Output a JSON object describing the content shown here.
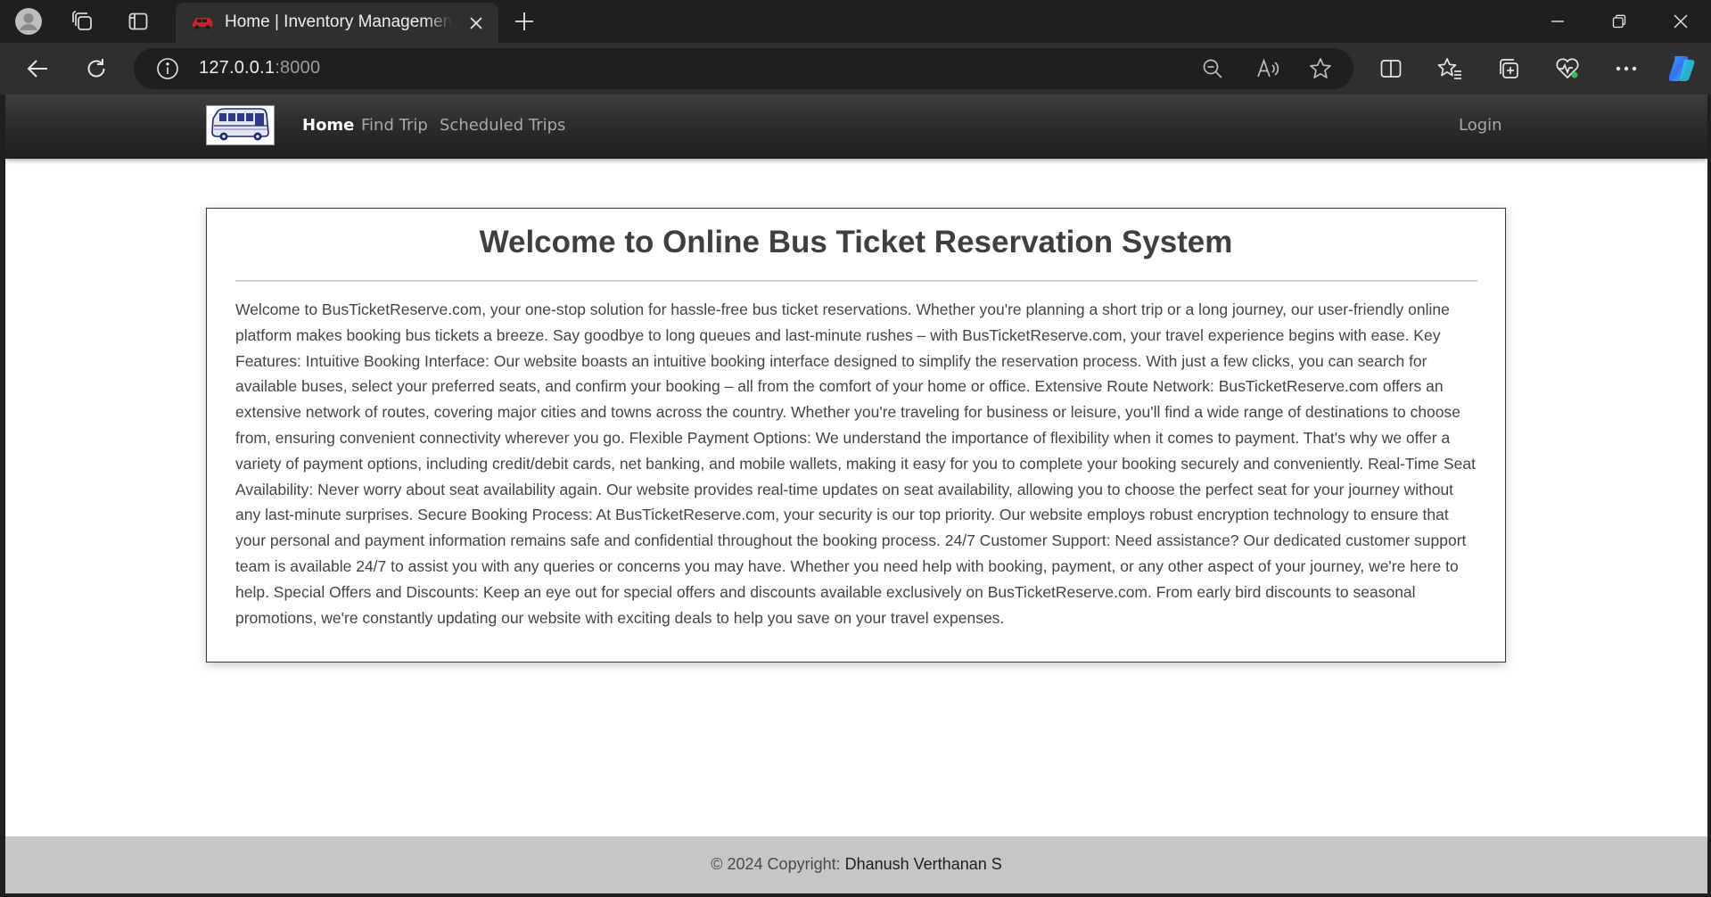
{
  "browser": {
    "tab_title": "Home | Inventory Management S",
    "url_host": "127.0.0.1",
    "url_port": ":8000"
  },
  "nav": {
    "links": [
      "Home",
      "Find Trip",
      "Scheduled Trips"
    ],
    "login_label": "Login"
  },
  "content": {
    "title": "Welcome to Online Bus Ticket Reservation System",
    "body": "Welcome to BusTicketReserve.com, your one-stop solution for hassle-free bus ticket reservations. Whether you're planning a short trip or a long journey, our user-friendly online platform makes booking bus tickets a breeze. Say goodbye to long queues and last-minute rushes – with BusTicketReserve.com, your travel experience begins with ease. Key Features: Intuitive Booking Interface: Our website boasts an intuitive booking interface designed to simplify the reservation process. With just a few clicks, you can search for available buses, select your preferred seats, and confirm your booking – all from the comfort of your home or office. Extensive Route Network: BusTicketReserve.com offers an extensive network of routes, covering major cities and towns across the country. Whether you're traveling for business or leisure, you'll find a wide range of destinations to choose from, ensuring convenient connectivity wherever you go. Flexible Payment Options: We understand the importance of flexibility when it comes to payment. That's why we offer a variety of payment options, including credit/debit cards, net banking, and mobile wallets, making it easy for you to complete your booking securely and conveniently. Real-Time Seat Availability: Never worry about seat availability again. Our website provides real-time updates on seat availability, allowing you to choose the perfect seat for your journey without any last-minute surprises. Secure Booking Process: At BusTicketReserve.com, your security is our top priority. Our website employs robust encryption technology to ensure that your personal and payment information remains safe and confidential throughout the booking process. 24/7 Customer Support: Need assistance? Our dedicated customer support team is available 24/7 to assist you with any queries or concerns you may have. Whether you need help with booking, payment, or any other aspect of your journey, we're here to help. Special Offers and Discounts: Keep an eye out for special offers and discounts available exclusively on BusTicketReserve.com. From early bird discounts to seasonal promotions, we're constantly updating our website with exciting deals to help you save on your travel expenses."
  },
  "footer": {
    "prefix": "© 2024 Copyright: ",
    "author": "Dhanush Verthanan S"
  },
  "icons": {
    "titlebar": [
      "profile-icon",
      "workspaces-icon",
      "tab-actions-icon",
      "new-tab-icon"
    ],
    "toolbar": [
      "back-icon",
      "refresh-icon",
      "site-info-icon",
      "zoom-out-icon",
      "read-aloud-icon",
      "favorite-star-icon",
      "split-screen-icon",
      "favorites-icon",
      "collections-icon",
      "browser-essentials-icon",
      "more-icon",
      "copilot-icon"
    ],
    "window": [
      "minimize-icon",
      "restore-icon",
      "close-window-icon"
    ]
  },
  "colors": {
    "navbar": "#2a2a2a",
    "footer": "#c6c6c6",
    "tab_favicon": "#c0272d"
  }
}
